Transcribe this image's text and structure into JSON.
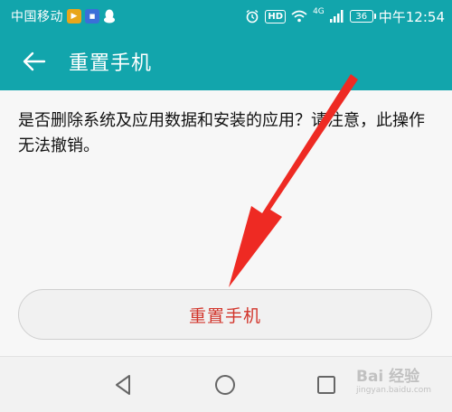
{
  "status_bar": {
    "carrier": "中国移动",
    "hd_label": "HD",
    "network_label": "4G",
    "battery": "36",
    "time": "中午12:54"
  },
  "app_bar": {
    "title": "重置手机"
  },
  "content": {
    "message": "是否删除系统及应用数据和安装的应用？请注意，此操作无法撤销。",
    "reset_button_label": "重置手机"
  },
  "watermark": {
    "text": "Bai 经验",
    "url": "jingyan.baidu.com"
  },
  "colors": {
    "accent": "#12a5ac",
    "warning_text": "#d2342a",
    "arrow": "#ee2a23"
  }
}
